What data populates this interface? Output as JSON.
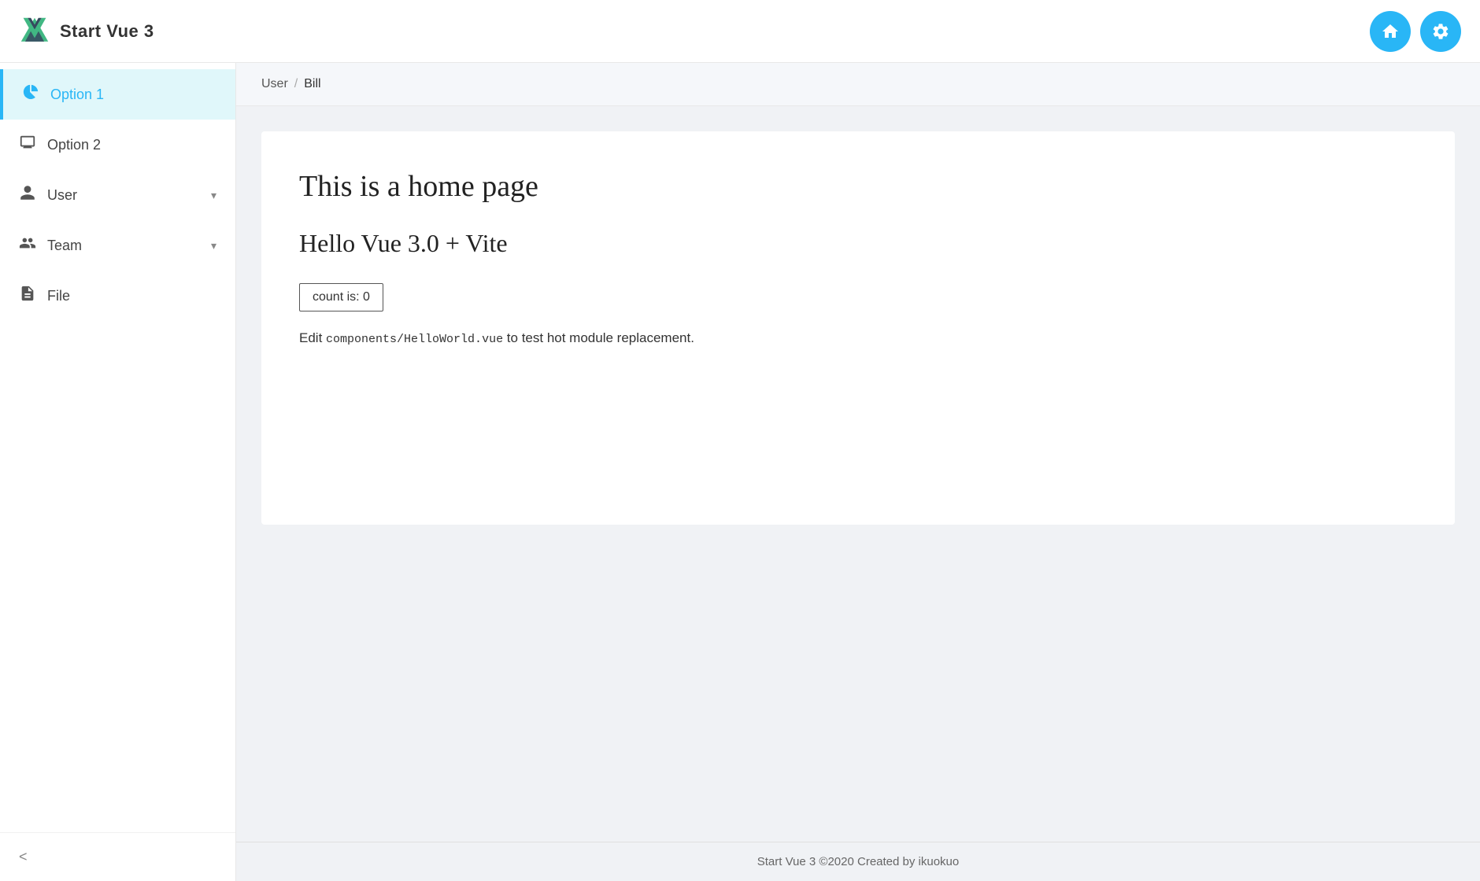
{
  "header": {
    "title": "Start Vue 3",
    "home_btn_label": "🏠",
    "settings_btn_label": "⚙"
  },
  "sidebar": {
    "items": [
      {
        "id": "option1",
        "label": "Option 1",
        "icon": "chart-pie",
        "active": true,
        "has_chevron": false
      },
      {
        "id": "option2",
        "label": "Option 2",
        "icon": "monitor",
        "active": false,
        "has_chevron": false
      },
      {
        "id": "user",
        "label": "User",
        "icon": "person",
        "active": false,
        "has_chevron": true
      },
      {
        "id": "team",
        "label": "Team",
        "icon": "people",
        "active": false,
        "has_chevron": true
      },
      {
        "id": "file",
        "label": "File",
        "icon": "file",
        "active": false,
        "has_chevron": false
      }
    ],
    "collapse_label": "<"
  },
  "breadcrumb": {
    "parent": "User",
    "separator": "/",
    "current": "Bill"
  },
  "main": {
    "heading": "This is a home page",
    "subheading": "Hello Vue 3.0 + Vite",
    "count_label": "count is: 0",
    "edit_hint_prefix": "Edit ",
    "edit_hint_code": "components/HelloWorld.vue",
    "edit_hint_suffix": " to test hot module replacement."
  },
  "footer": {
    "text": "Start Vue 3 ©2020 Created by ikuokuo"
  }
}
